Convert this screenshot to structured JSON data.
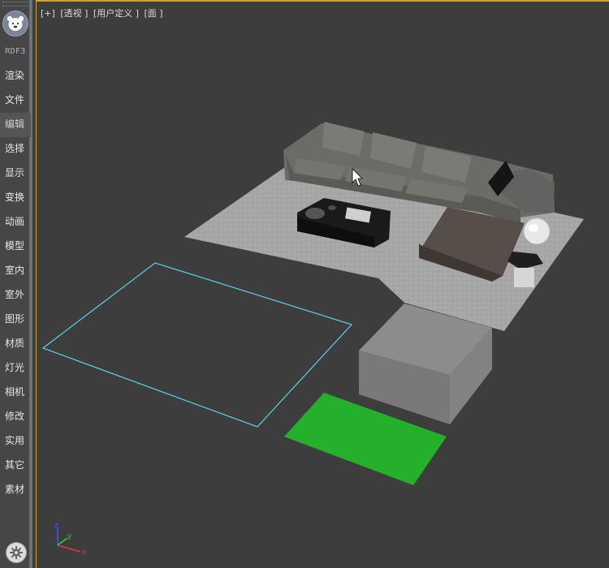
{
  "sidebar": {
    "brand": "RDF3",
    "items": [
      {
        "label": "渲染"
      },
      {
        "label": "文件"
      },
      {
        "label": "编辑"
      },
      {
        "label": "选择"
      },
      {
        "label": "显示"
      },
      {
        "label": "变换"
      },
      {
        "label": "动画"
      },
      {
        "label": "模型"
      },
      {
        "label": "室内"
      },
      {
        "label": "室外"
      },
      {
        "label": "图形"
      },
      {
        "label": "材质"
      },
      {
        "label": "灯光"
      },
      {
        "label": "相机"
      },
      {
        "label": "修改"
      },
      {
        "label": "实用"
      },
      {
        "label": "其它"
      },
      {
        "label": "素材"
      }
    ],
    "active_index": 2
  },
  "viewport": {
    "labels": [
      "[+]",
      "[透视 ]",
      "[用户定义 ]",
      "[面 ]"
    ],
    "axis": {
      "x": "x",
      "y": "y",
      "z": "z"
    }
  },
  "colors": {
    "viewport_bg": "#3d3d3d",
    "active_border": "#c9a43a",
    "selection_outline": "#5fd0e8",
    "green_plane": "#24b02a"
  },
  "icons": {
    "logo": "bear-logo-icon",
    "settings": "gear-icon",
    "cursor": "arrow-cursor-icon"
  }
}
